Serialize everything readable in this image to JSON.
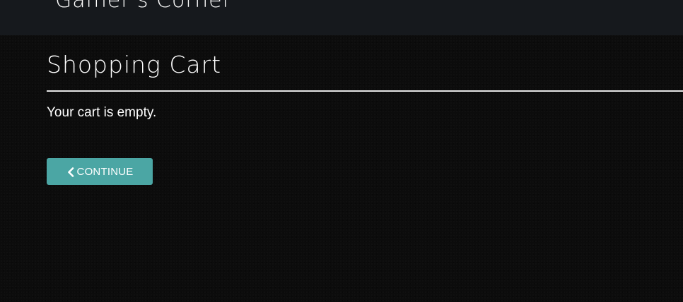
{
  "header": {
    "brand": "Gamer's Corner"
  },
  "main": {
    "title": "Shopping Cart",
    "empty_message": "Your cart is empty.",
    "continue_button": {
      "label": "CONTINUE",
      "icon": "chevron-left-icon"
    }
  },
  "colors": {
    "background": "#0c0c0c",
    "header_bar": "#16191d",
    "accent": "#4ba6a4",
    "text": "#ffffff"
  }
}
